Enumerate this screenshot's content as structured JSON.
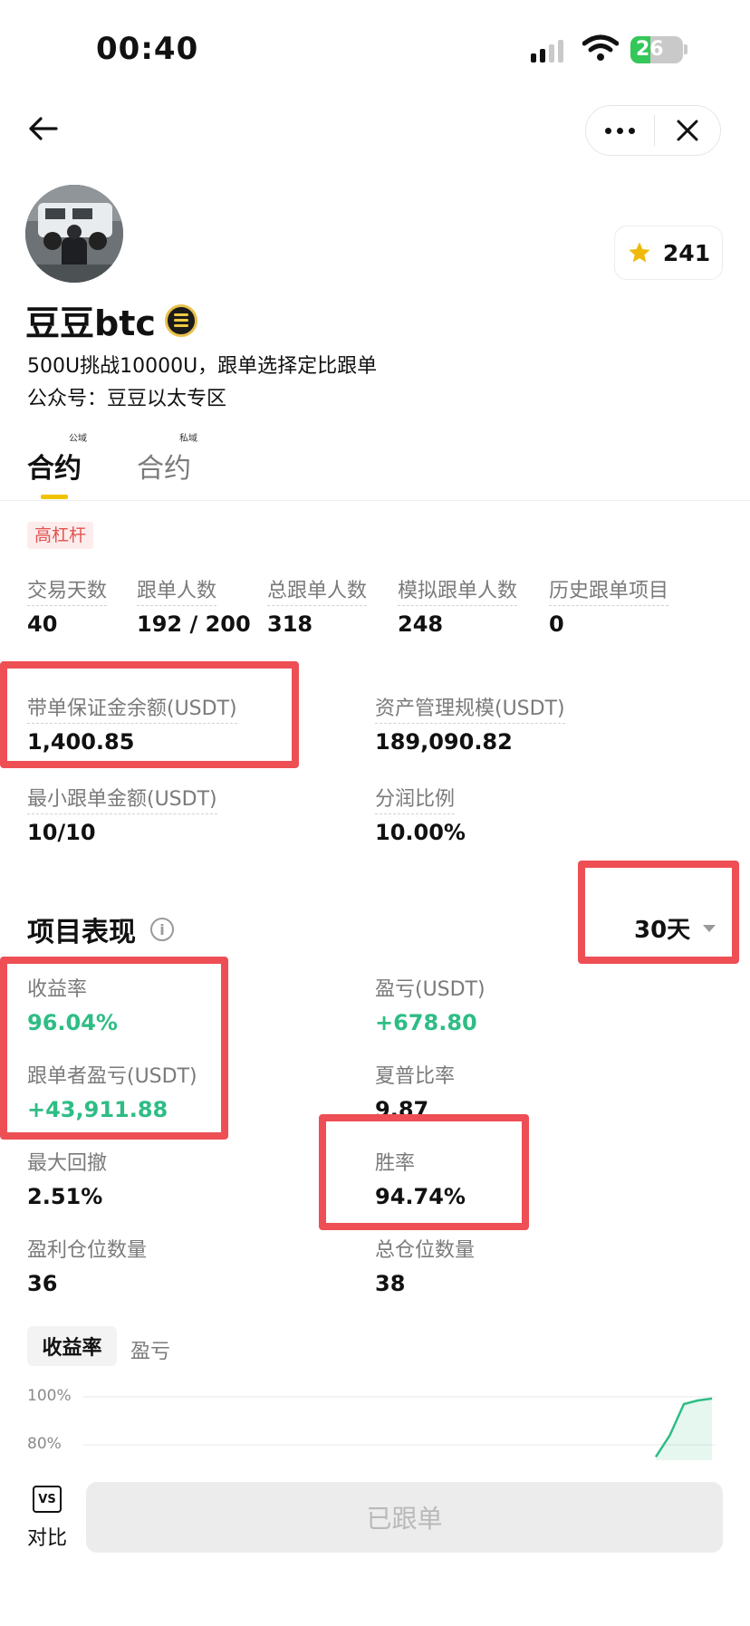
{
  "status_bar": {
    "time": "00:40",
    "battery": "26"
  },
  "nav": {
    "back_icon": "back-arrow-icon",
    "more_icon": "more-dots-icon",
    "close_icon": "close-icon"
  },
  "profile": {
    "name": "豆豆btc",
    "star_count": "241",
    "bio_line1": "500U挑战10000U，跟单选择定比跟单",
    "bio_line2": "公众号：豆豆以太专区"
  },
  "tabs": [
    {
      "label": "合约",
      "sup": "公域",
      "active": true
    },
    {
      "label": "合约",
      "sup": "私域",
      "active": false
    }
  ],
  "tag": "高杠杆",
  "stats_row": [
    {
      "label": "交易天数",
      "value": "40"
    },
    {
      "label": "跟单人数",
      "value": "192 / 200"
    },
    {
      "label": "总跟单人数",
      "value": "318"
    },
    {
      "label": "模拟跟单人数",
      "value": "248"
    },
    {
      "label": "历史跟单项目",
      "value": "0"
    }
  ],
  "fund_stats": [
    {
      "label": "带单保证金余额(USDT)",
      "value": "1,400.85"
    },
    {
      "label": "资产管理规模(USDT)",
      "value": "189,090.82"
    },
    {
      "label": "最小跟单金额(USDT)",
      "value": "10/10"
    },
    {
      "label": "分润比例",
      "value": "10.00%"
    }
  ],
  "performance": {
    "title": "项目表现",
    "info_icon": "i",
    "period": "30天",
    "items": [
      {
        "label": "收益率",
        "value": "96.04%"
      },
      {
        "label": "盈亏(USDT)",
        "value": "+678.80"
      },
      {
        "label": "跟单者盈亏(USDT)",
        "value": "+43,911.88"
      },
      {
        "label": "夏普比率",
        "value": "9.87"
      },
      {
        "label": "最大回撤",
        "value": "2.51%"
      },
      {
        "label": "胜率",
        "value": "94.74%"
      },
      {
        "label": "盈利仓位数量",
        "value": "36"
      },
      {
        "label": "总仓位数量",
        "value": "38"
      }
    ]
  },
  "chart_tabs": {
    "active": "收益率",
    "inactive": "盈亏"
  },
  "chart_data": {
    "type": "area",
    "yticks": [
      "100%",
      "80%"
    ],
    "ylim": [
      80,
      100
    ],
    "series": [
      {
        "values": [
          75,
          84,
          97,
          98.5,
          99.3
        ]
      }
    ],
    "color": "#2ebd85"
  },
  "bottom": {
    "compare_icon": "VS",
    "compare_label": "对比",
    "follow_button": "已跟单"
  },
  "colors": {
    "accent_yellow": "#f0c300",
    "green": "#2ebd85",
    "highlight_red": "#ee4f55",
    "tag_red": "#e0524f"
  }
}
